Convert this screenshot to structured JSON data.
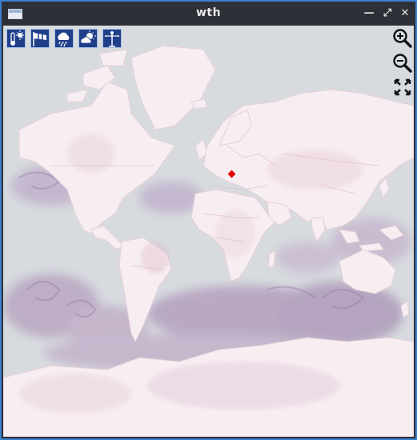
{
  "window": {
    "title": "wth"
  },
  "titlebar_icons": [
    "window-icon",
    "minimize-icon",
    "restore-icon",
    "close-icon"
  ],
  "toolbar": {
    "layers": [
      {
        "name": "temperature-layer-button",
        "icon": "thermometer-sun-icon"
      },
      {
        "name": "wind-layer-button",
        "icon": "windsock-icon"
      },
      {
        "name": "precipitation-layer-button",
        "icon": "cloud-rain-icon"
      },
      {
        "name": "clouds-layer-button",
        "icon": "cloud-sun-icon"
      },
      {
        "name": "pressure-layer-button",
        "icon": "weather-station-icon"
      }
    ]
  },
  "map_controls": [
    "zoom-in-icon",
    "zoom-out-icon",
    "fullscreen-icon"
  ],
  "colors": {
    "accent_border": "#3d7fd0",
    "ocean": "#d7dbdf",
    "land": "#f7eef2",
    "overlay": "#7a4f8c",
    "marker": "#e30000",
    "button_bg": "#1f3f8a"
  }
}
